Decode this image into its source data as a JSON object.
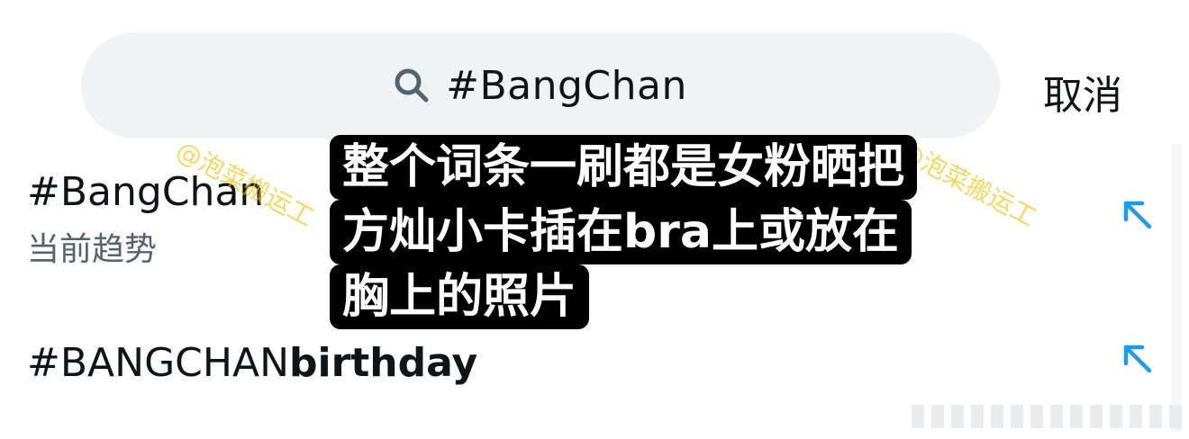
{
  "search": {
    "query": "#BangChan",
    "cancel_label": "取消"
  },
  "results": [
    {
      "tag": "#BangChan",
      "tag_bold": "",
      "subtitle": "当前趋势"
    },
    {
      "tag": "#BANGCHAN",
      "tag_bold": "birthday",
      "subtitle": ""
    }
  ],
  "overlay": {
    "lines": [
      "整个词条一刷都是女粉晒把",
      "方灿小卡插在bra上或放在",
      "胸上的照片"
    ]
  },
  "watermark": "@泡菜搬运工",
  "colors": {
    "accent": "#1d9bf0",
    "search_bg": "#eff3f4",
    "secondary_text": "#536471"
  }
}
